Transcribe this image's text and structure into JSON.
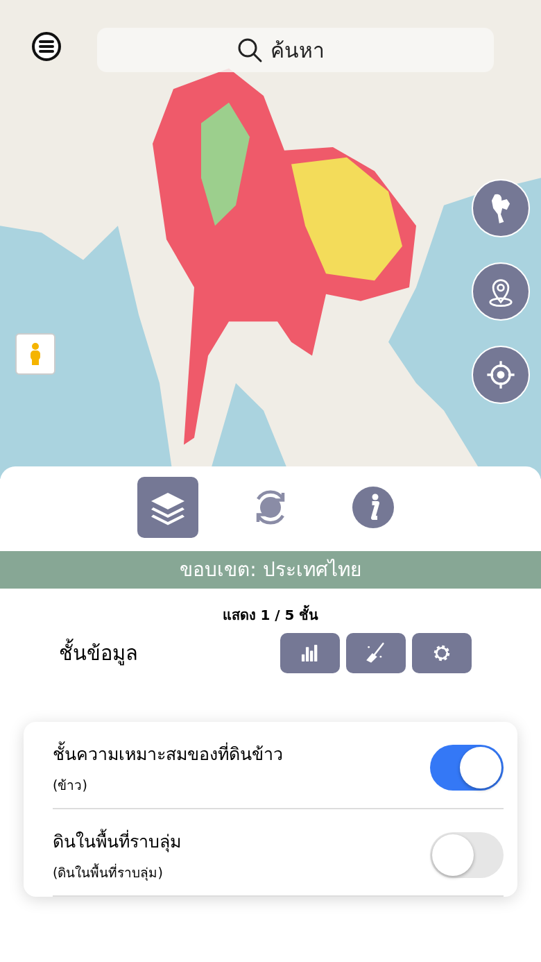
{
  "search": {
    "placeholder": "ค้นหา"
  },
  "map_controls": [
    {
      "kind": "country"
    },
    {
      "kind": "pin"
    },
    {
      "kind": "locate"
    }
  ],
  "tabs": [
    {
      "kind": "layers",
      "selected": true
    },
    {
      "kind": "refresh",
      "selected": false
    },
    {
      "kind": "info",
      "selected": false
    }
  ],
  "scope_bar": "ขอบเขต: ประเทศไทย",
  "layer_count": "แสดง 1 / 5 ชั้น",
  "section_title": "ชั้นข้อมูล",
  "tools": [
    {
      "kind": "chart"
    },
    {
      "kind": "clean"
    },
    {
      "kind": "settings"
    }
  ],
  "layers": [
    {
      "name": "ชั้นความเหมาะสมของที่ดินข้าว",
      "subtitle": "(ข้าว)",
      "on": true
    },
    {
      "name": "ดินในพื้นที่ราบลุ่ม",
      "subtitle": "(ดินในพื้นที่ราบลุ่ม)",
      "on": false
    }
  ]
}
